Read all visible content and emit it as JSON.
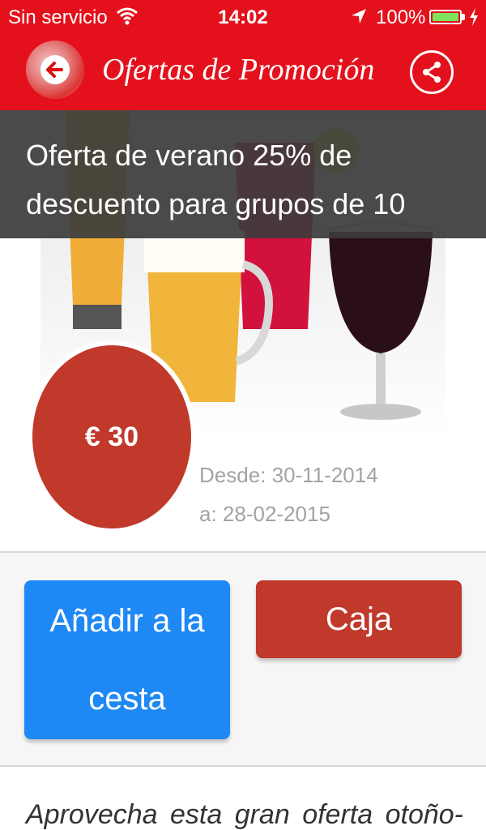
{
  "status_bar": {
    "carrier": "Sin servicio",
    "time": "14:02",
    "battery": "100%"
  },
  "nav": {
    "title": "Ofertas de Promoción"
  },
  "offer": {
    "headline": "Oferta de verano 25% de descuento para grupos de 10",
    "price": "€ 30",
    "from": "Desde: 30-11-2014",
    "to": "a: 28-02-2015",
    "description": "Aprovecha esta gran oferta otoño-"
  },
  "actions": {
    "add_to_cart": "Añadir a la cesta",
    "checkout": "Caja"
  },
  "colors": {
    "header_red": "#e4111c",
    "price_red": "#c0392b",
    "button_blue": "#1e88f5",
    "checkout_red": "#c0392b"
  }
}
